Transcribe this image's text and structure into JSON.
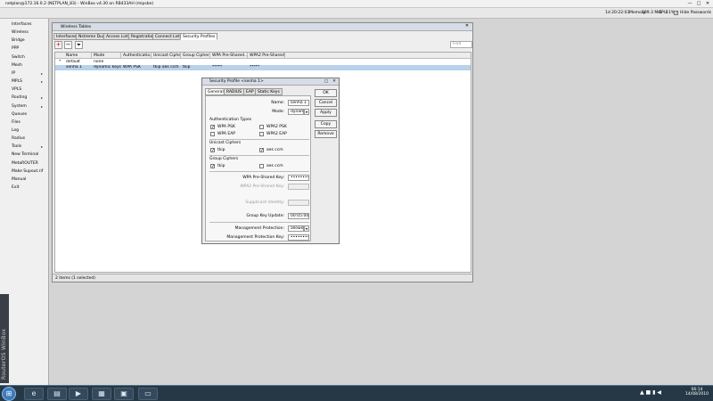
{
  "window": {
    "title": "netplan@172.16.0.2 (NETPLAN_83) - WinBox v4.30 on RB433AH (mipsbe)",
    "minimize": "—",
    "maximize": "□",
    "close": "✕"
  },
  "toolbar": {
    "uptime": "1d 20:22:03",
    "memory_label": "Memory:",
    "memory_value": "109.3 MiB",
    "cpu_label": "CPU:",
    "cpu_value": "11%",
    "hide_passwords": "Hide Passwords",
    "hide_passwords_checked": "✓"
  },
  "menu": {
    "items": [
      {
        "label": "Interfaces",
        "arrow": ""
      },
      {
        "label": "Wireless",
        "arrow": ""
      },
      {
        "label": "Bridge",
        "arrow": ""
      },
      {
        "label": "PPP",
        "arrow": ""
      },
      {
        "label": "Switch",
        "arrow": ""
      },
      {
        "label": "Mesh",
        "arrow": ""
      },
      {
        "label": "IP",
        "arrow": "▸"
      },
      {
        "label": "MPLS",
        "arrow": "▸"
      },
      {
        "label": "VPLS",
        "arrow": ""
      },
      {
        "label": "Routing",
        "arrow": "▸"
      },
      {
        "label": "System",
        "arrow": "▸"
      },
      {
        "label": "Queues",
        "arrow": ""
      },
      {
        "label": "Files",
        "arrow": ""
      },
      {
        "label": "Log",
        "arrow": ""
      },
      {
        "label": "Radius",
        "arrow": ""
      },
      {
        "label": "Tools",
        "arrow": "▸"
      },
      {
        "label": "New Terminal",
        "arrow": ""
      },
      {
        "label": "MetaROUTER",
        "arrow": ""
      },
      {
        "label": "Make Supout.rif",
        "arrow": ""
      },
      {
        "label": "Manual",
        "arrow": ""
      },
      {
        "label": "Exit",
        "arrow": ""
      }
    ],
    "brand": "RouterOS WinBox"
  },
  "wireless_tables": {
    "title": "Wireless Tables",
    "tabs": [
      "Interfaces",
      "Nstreme Dual",
      "Access List",
      "Registration",
      "Connect List",
      "Security Profiles"
    ],
    "active_tab": "Security Profiles",
    "find_placeholder": "Find",
    "columns": [
      "Name",
      "Mode",
      "Authenticatio...",
      "Unicast Ciphers",
      "Group Ciphers",
      "WPA Pre-Shared...",
      "WPA2 Pre-Shared..."
    ],
    "rows": [
      {
        "flag": "*",
        "name": "default",
        "mode": "none",
        "auth": "",
        "unicast": "",
        "group": "",
        "wpa": "",
        "wpa2": ""
      },
      {
        "flag": "",
        "name": "senha 1",
        "mode": "dynamic keys",
        "auth": "WPA PSK",
        "unicast": "tkip aes ccm",
        "group": "tkip",
        "wpa": "*****",
        "wpa2": "*****"
      }
    ],
    "status": "2 items (1 selected)"
  },
  "dialog": {
    "title": "Security Profile <senha 1>",
    "tabs": [
      "General",
      "RADIUS",
      "EAP",
      "Static Keys"
    ],
    "active_tab": "General",
    "buttons": [
      "OK",
      "Cancel",
      "Apply",
      "Copy",
      "Remove"
    ],
    "name_label": "Name:",
    "name_value": "senha 1",
    "mode_label": "Mode:",
    "mode_value": "dynamic keys",
    "auth_types_label": "Authentication Types",
    "wpa_psk": "WPA PSK",
    "wpa2_psk": "WPA2 PSK",
    "wpa_eap": "WPA EAP",
    "wpa2_eap": "WPA2 EAP",
    "unicast_label": "Unicast Ciphers",
    "group_label": "Group Ciphers",
    "tkip": "tkip",
    "aes_ccm": "aes ccm",
    "check": "✓",
    "wpa_key_label": "WPA Pre-Shared Key:",
    "wpa_key_value": "••••••••••••••••••",
    "wpa2_key_label": "WPA2 Pre-Shared Key:",
    "supplicant_label": "Supplicant Identity:",
    "group_update_label": "Group Key Update:",
    "group_update_value": "00:05:00",
    "mgmt_prot_label": "Management Protection:",
    "mgmt_prot_value": "allowed",
    "mgmt_key_label": "Management Protection Key:",
    "mgmt_key_value": "••••••••"
  },
  "taskbar": {
    "start_icon": "⊞",
    "apps": [
      {
        "icon": "e",
        "name": "ie-icon"
      },
      {
        "icon": "▤",
        "name": "explorer-icon"
      },
      {
        "icon": "▶",
        "name": "media-player-icon"
      },
      {
        "icon": "▦",
        "name": "network-app-icon"
      },
      {
        "icon": "▣",
        "name": "winbox-icon"
      },
      {
        "icon": "▭",
        "name": "window-icon"
      }
    ],
    "tray": "▲ ■ ▮ ◀",
    "time": "06:14",
    "date": "14/08/2010"
  }
}
